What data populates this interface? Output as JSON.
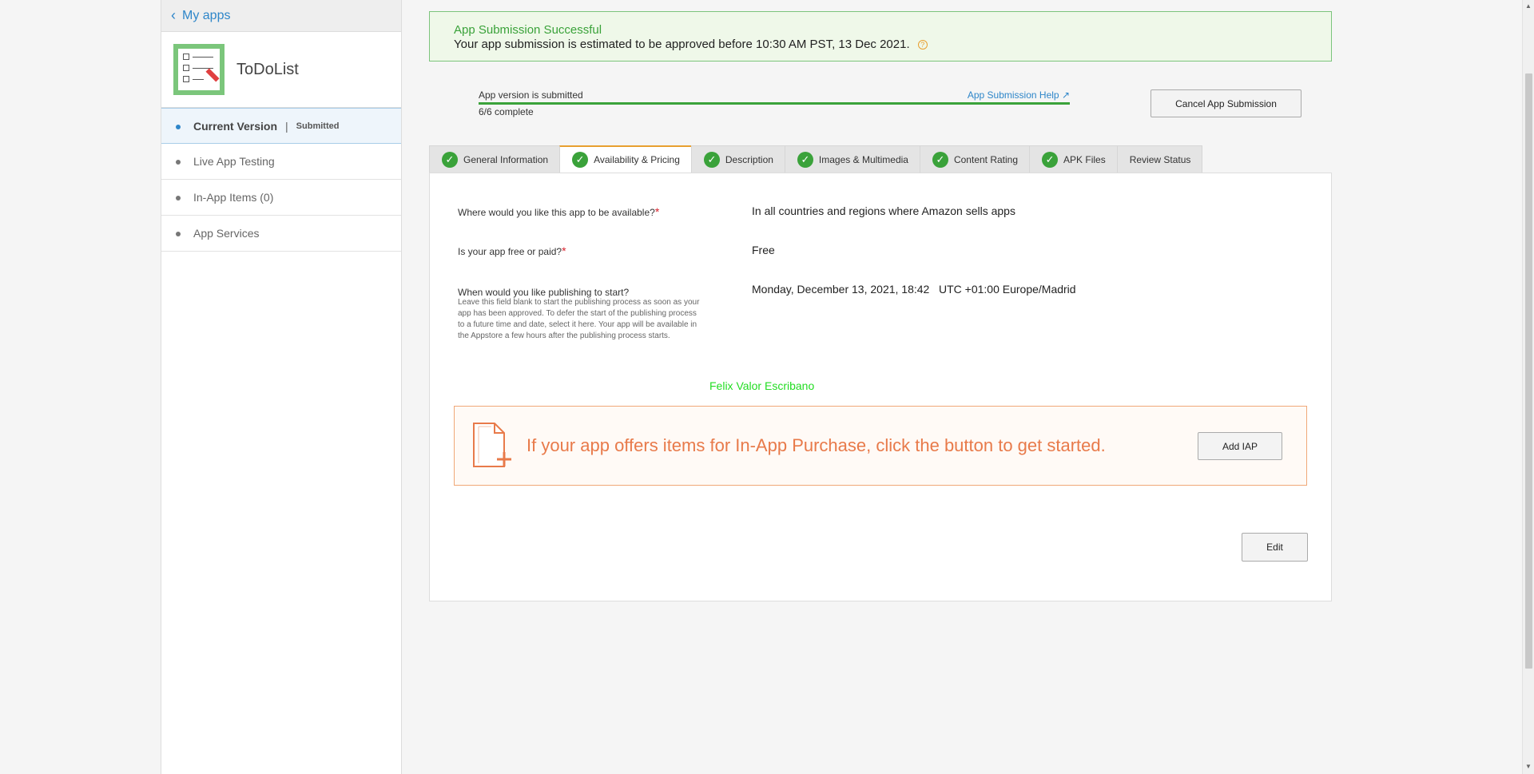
{
  "sidebar": {
    "back_label": "My apps",
    "app_name": "ToDoList",
    "items": [
      {
        "label": "Current Version",
        "status": "Submitted",
        "sep": "|"
      },
      {
        "label": "Live App Testing"
      },
      {
        "label": "In-App Items (0)"
      },
      {
        "label": "App Services"
      }
    ]
  },
  "banner": {
    "title": "App Submission Successful",
    "text": "Your app submission is estimated to be approved before 10:30 AM PST, 13 Dec 2021.",
    "help_glyph": "?"
  },
  "progress": {
    "label": "App version is submitted",
    "help_link": "App Submission Help",
    "sub": "6/6 complete",
    "fraction": 1.0
  },
  "cancel_button": "Cancel App Submission",
  "tabs": [
    {
      "label": "General Information",
      "done": true
    },
    {
      "label": "Availability & Pricing",
      "done": true,
      "active": true
    },
    {
      "label": "Description",
      "done": true
    },
    {
      "label": "Images & Multimedia",
      "done": true
    },
    {
      "label": "Content Rating",
      "done": true
    },
    {
      "label": "APK Files",
      "done": true
    },
    {
      "label": "Review Status",
      "done": false
    }
  ],
  "form": {
    "q1": "Where would you like this app to be available?",
    "a1": "In all countries and regions where Amazon sells apps",
    "q2": "Is your app free or paid?",
    "a2": "Free",
    "q3": "When would you like publishing to start?",
    "q3_help": "Leave this field blank to start the publishing process as soon as your app has been approved. To defer the start of the publishing process to a future time and date, select it here. Your app will be available in the Appstore a few hours after the publishing process starts.",
    "a3": "Monday, December 13, 2021, 18:42   UTC +01:00 Europe/Madrid",
    "required_mark": "*"
  },
  "signature": "Felix Valor Escribano",
  "iap": {
    "text": "If your app offers items for In-App Purchase, click the button to get started.",
    "button": "Add IAP"
  },
  "edit_button": "Edit",
  "colors": {
    "accent": "#2e86c9",
    "success": "#3aa23a",
    "orange": "#e87a4a"
  }
}
